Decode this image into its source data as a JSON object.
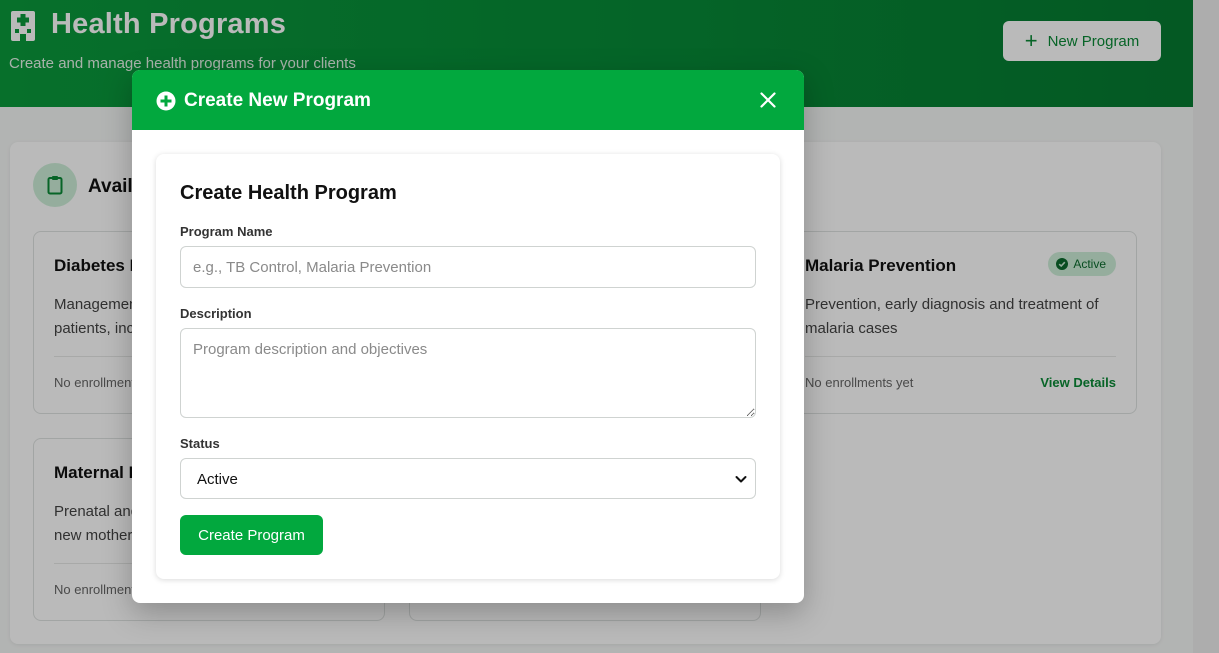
{
  "header": {
    "title": "Health Programs",
    "subtitle": "Create and manage health programs for your clients",
    "new_program_label": "New Program"
  },
  "panel": {
    "title": "Available Programs"
  },
  "cards": [
    {
      "name": "Diabetes Management",
      "description": "Management and monitoring of diabetic patients, including...",
      "enrollments": "No enrollments yet"
    },
    {
      "name": "Malaria Prevention",
      "status": "Active",
      "description": "Prevention, early diagnosis and treatment of malaria cases",
      "enrollments": "No enrollments yet",
      "link": "View Details"
    },
    {
      "name": "Maternal Health",
      "description": "Prenatal and postnatal care for mothers and new mothers",
      "enrollments": "No enrollments yet"
    }
  ],
  "modal": {
    "title": "Create New Program",
    "form_title": "Create Health Program",
    "fields": {
      "name_label": "Program Name",
      "name_placeholder": "e.g., TB Control, Malaria Prevention",
      "description_label": "Description",
      "description_placeholder": "Program description and objectives",
      "status_label": "Status",
      "status_value": "Active"
    },
    "submit_label": "Create Program"
  },
  "colors": {
    "brand": "#02a83e",
    "brand_dark": "#078a37",
    "link": "#0a8a36",
    "badge_bg": "#cdeed8"
  },
  "icons": {
    "header": "hospital-icon",
    "panel": "clipboard-icon",
    "modal": "plus-circle-icon",
    "close": "close-icon",
    "badge": "check-circle-icon",
    "select": "chevron-down-icon"
  }
}
